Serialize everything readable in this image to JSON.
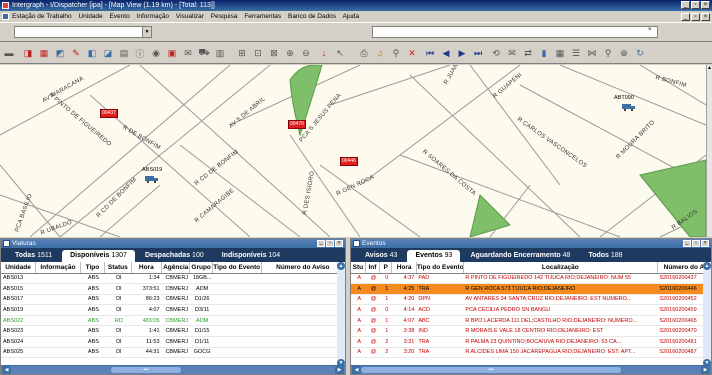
{
  "window": {
    "title": "Intergraph - I/Dispatcher [ipa] - [Map View (1.19 km) - [Total: 113]]"
  },
  "menu": {
    "items": [
      "Estação de Trabalho",
      "Unidade",
      "Evento",
      "Informação",
      "Visualizar",
      "Pesquisa",
      "Ferramentas",
      "Banco de Dados",
      "Ajuda"
    ]
  },
  "map": {
    "streets": [
      "AV MARACANA",
      "R PINTO DE FIGUEIREDO",
      "R CD DE BONFIM",
      "PCA S JESUS PENA",
      "R GUAPENI",
      "R CARLOS VASCONCELOS",
      "R SOARES DA COSTA",
      "R CD DE BONFIM",
      "R CAMARAGIBE",
      "R DES ISIDRO",
      "R GEN ROCA",
      "R MOURA BRITO",
      "R BONFIM",
      "R UBALDO",
      "AV 5 DE ABRIL",
      "R JUAN",
      "R DE BONFIM",
      "PCA BASILIO",
      "R BALIOS"
    ],
    "markers": [
      "00437",
      "00470",
      "00446"
    ],
    "units": [
      "ABS019",
      "ABT090"
    ]
  },
  "vehicles": {
    "title": "Viaturas",
    "tabs": [
      {
        "label": "Todas",
        "count": "1511"
      },
      {
        "label": "Disponíveis",
        "count": "1307"
      },
      {
        "label": "Despachadas",
        "count": "100"
      },
      {
        "label": "Indisponíveis",
        "count": "104"
      }
    ],
    "columns": [
      "Unidade",
      "Informação",
      "Tipo",
      "Status",
      "Hora",
      "Agência",
      "Grupo",
      "Tipo do Evento",
      "Número do Aviso"
    ],
    "rows": [
      [
        "ABS013",
        "",
        "ABS",
        "DI",
        "1:34",
        "CBMERJ",
        "18GB...",
        "",
        ""
      ],
      [
        "ABS015",
        "",
        "ABS",
        "DI",
        "373:51",
        "CBMERJ",
        "ADM",
        "",
        ""
      ],
      [
        "ABS017",
        "",
        "ABS",
        "DI",
        "86:23",
        "CBMERJ",
        "D1/26",
        "",
        ""
      ],
      [
        "ABS019",
        "",
        "ABS",
        "DI",
        "4:07",
        "CBMERJ",
        "D3/11",
        "",
        ""
      ],
      [
        "ABS022",
        "",
        "ABS",
        "RD",
        "483:05",
        "CBMERJ",
        "ADM",
        "",
        ""
      ],
      [
        "ABS023",
        "",
        "ABS",
        "DI",
        "1:41",
        "CBMERJ",
        "D1/15",
        "",
        ""
      ],
      [
        "ABS024",
        "",
        "ABS",
        "DI",
        "11:53",
        "CBMERJ",
        "D1/11",
        "",
        ""
      ],
      [
        "ABS025",
        "",
        "ABS",
        "DI",
        "44:31",
        "CBMERJ",
        "GOCG",
        "",
        ""
      ]
    ]
  },
  "events": {
    "title": "Eventos",
    "tabs": [
      {
        "label": "Avisos",
        "count": "43"
      },
      {
        "label": "Eventos",
        "count": "93"
      },
      {
        "label": "Aguardando Encerramento",
        "count": "48"
      },
      {
        "label": "Todos",
        "count": "188"
      }
    ],
    "columns": [
      "Stu",
      "Inf",
      "P",
      "Hora",
      "Tipo do Evento",
      "Localização",
      "Número do A"
    ],
    "rows": [
      [
        "A",
        "@",
        "0",
        "4:37",
        "PAD",
        "R PINTO DE FIGUEIREDO 142 TIJUCA RIO;DEJANEIRO: NUM 55",
        "S20160200437"
      ],
      [
        "A",
        "@",
        "1",
        "4:25",
        "TRA",
        "R GEN ROCA 573 TIJUCA RIO;DEJANEIRO",
        "S20160200446"
      ],
      [
        "A",
        "@",
        "1",
        "4:20",
        "DPN",
        "AV ANTARES 34 SANTA;CRUZ RIO;DEJANEIRO: EST NUMERO...",
        "S20160200452"
      ],
      [
        "A",
        "@",
        "0",
        "4:14",
        "ACD",
        "PCA CECILIA PEDRO SN BANGU",
        "S20160200459"
      ],
      [
        "A",
        "@",
        "1",
        "4:07",
        "ABC",
        "R BPO LACERDA 111 DEL;CASTILHO RIO;DEJANEIRO: NUMERO...",
        "S20160200465"
      ],
      [
        "A",
        "@",
        "1",
        "3:38",
        "IND",
        "R MORAIS E VALE 18 CENTRO RIO;DEJANEIRO: EST",
        "S20160200470"
      ],
      [
        "A",
        "@",
        "2",
        "3:31",
        "TRA",
        "R PALMA 23 QUINTINO;BOCAIUVA RIO;DEJANEIRO: 53 CA...",
        "S20160200481"
      ],
      [
        "A",
        "@",
        "2",
        "3:20",
        "TRA",
        "R ALCIDES LIMA 150 JACAREPAGUA RIO;DEJANEIRO: EST: APT...",
        "S20160200487"
      ]
    ]
  }
}
